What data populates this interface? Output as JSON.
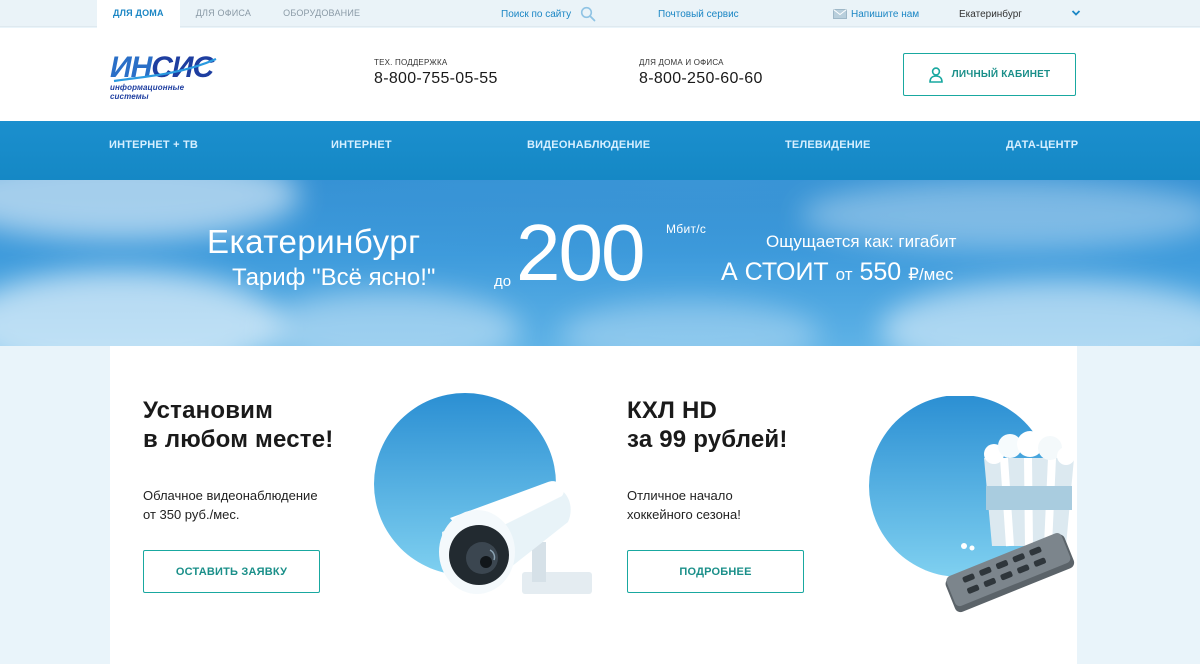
{
  "topbar": {
    "tabs": [
      {
        "label": "Для дома",
        "active": true
      },
      {
        "label": "Для офиса",
        "active": false
      },
      {
        "label": "Оборудование",
        "active": false
      }
    ],
    "search_label": "Поиск по сайту",
    "mail_label": "Почтовый сервис",
    "write_label": "Напишите нам",
    "city": "Екатеринбург"
  },
  "header": {
    "logo_main": "ИНСИС",
    "logo_part1": "ИН",
    "logo_part2": "СИС",
    "logo_sub": "информационные системы",
    "support_label": "Тех. поддержка",
    "support_phone": "8-800-755-05-55",
    "sales_label": "Для дома и офиса",
    "sales_phone": "8-800-250-60-60",
    "cabinet_label": "Личный кабинет"
  },
  "nav": {
    "items": [
      "Интернет + ТВ",
      "Интернет",
      "Видеонаблюдение",
      "Телевидение",
      "Дата-центр"
    ]
  },
  "banner": {
    "city": "Екатеринбург",
    "tariff": "Тариф \"Всё ясно!\"",
    "speed_prefix": "до",
    "speed": "200",
    "speed_unit": "Мбит/с",
    "feels_like": "Ощущается как: гигабит",
    "price_text": "А СТОИТ",
    "price_from": "от",
    "price_value": "550",
    "price_unit": "₽/мес"
  },
  "cards": [
    {
      "title_line1": "Установим",
      "title_line2": "в любом месте!",
      "desc_line1": "Облачное видеонаблюдение",
      "desc_line2": "от 350 руб./мес.",
      "button": "Оставить заявку"
    },
    {
      "title_line1": "КХЛ HD",
      "title_line2": "за 99 рублей!",
      "desc_line1": "Отличное начало",
      "desc_line2": "хоккейного сезона!",
      "button": "Подробнее"
    }
  ],
  "colors": {
    "accent": "#1b86c4",
    "nav_bg": "#1588c5",
    "button_border": "#19a8a0",
    "page_bg": "#e9f4fa"
  },
  "icons": [
    "search-icon",
    "envelope-icon",
    "chevron-down-icon",
    "user-icon",
    "security-camera-illustration",
    "popcorn-remote-illustration"
  ]
}
